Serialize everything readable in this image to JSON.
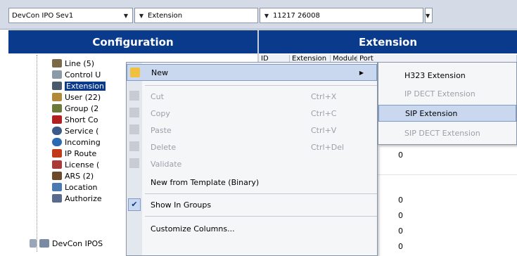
{
  "toolbar": {
    "combo1": "DevCon IPO Sev1",
    "combo2": "Extension",
    "combo3": "11217 26008"
  },
  "headers": {
    "configuration": "Configuration",
    "extension": "Extension"
  },
  "tree": {
    "items": [
      {
        "label": "Line (5)"
      },
      {
        "label": "Control U"
      },
      {
        "label": "Extension"
      },
      {
        "label": "User (22)"
      },
      {
        "label": "Group (2"
      },
      {
        "label": "Short Co"
      },
      {
        "label": "Service ("
      },
      {
        "label": "Incoming"
      },
      {
        "label": "IP Route"
      },
      {
        "label": "License ("
      },
      {
        "label": "ARS (2)"
      },
      {
        "label": "Location"
      },
      {
        "label": "Authorize"
      },
      {
        "label": "DevCon IPOS"
      }
    ]
  },
  "table": {
    "columns": [
      "ID",
      "Extension",
      "Module",
      "Port"
    ],
    "port_values": [
      "0",
      "0",
      "0",
      "0",
      "0"
    ]
  },
  "context_menu": {
    "items": [
      {
        "label": "New",
        "shortcut": "",
        "submenu_arrow": "▶"
      },
      {
        "label": "Cut",
        "shortcut": "Ctrl+X"
      },
      {
        "label": "Copy",
        "shortcut": "Ctrl+C"
      },
      {
        "label": "Paste",
        "shortcut": "Ctrl+V"
      },
      {
        "label": "Delete",
        "shortcut": "Ctrl+Del"
      },
      {
        "label": "Validate",
        "shortcut": ""
      },
      {
        "label": "New from Template (Binary)",
        "shortcut": ""
      },
      {
        "label": "Show In Groups",
        "shortcut": ""
      },
      {
        "label": "Customize Columns...",
        "shortcut": ""
      }
    ]
  },
  "submenu": {
    "items": [
      {
        "label": "H323 Extension"
      },
      {
        "label": "IP DECT Extension"
      },
      {
        "label": "SIP Extension"
      },
      {
        "label": "SIP DECT Extension"
      }
    ]
  },
  "colors": {
    "header_bg": "#0a3a8c",
    "highlight_bg": "#c9d8ef",
    "toolbar_bg": "#d4dbe7"
  }
}
